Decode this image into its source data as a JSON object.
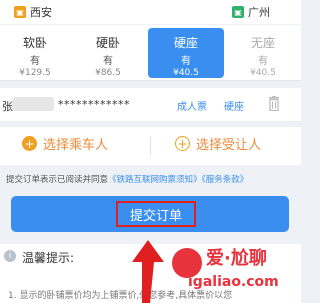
{
  "route": {
    "from": "西安",
    "to": "广州"
  },
  "seats": [
    {
      "name": "软卧",
      "availability": "有",
      "price": "¥129.5"
    },
    {
      "name": "硬卧",
      "availability": "有",
      "price": "¥86.5"
    },
    {
      "name": "硬座",
      "availability": "有",
      "price": "¥40.5",
      "selected": true
    },
    {
      "name": "无座",
      "availability": "有",
      "price": "¥40.5"
    }
  ],
  "passenger": {
    "name": "张",
    "id_masked": "************",
    "ticket_type": "成人票",
    "seat": "硬座"
  },
  "actions": {
    "select_passenger": "选择乘车人",
    "select_recipient": "选择受让人"
  },
  "agreement": {
    "prefix": "提交订单表示已阅读并同意",
    "link1": "《铁路互联网购票须知》",
    "link2": "《服务条款》"
  },
  "submit_label": "提交订单",
  "tips": {
    "title": "温馨提示:",
    "line1": "1. 显示的卧铺票价均为上铺票价,供您参考,具体票价以您"
  },
  "watermark": {
    "title": "爱·尬聊",
    "url": "igaliao.com"
  },
  "colors": {
    "accent": "#3a8ef0",
    "orange": "#f0a020",
    "highlight_red": "#e02020"
  }
}
